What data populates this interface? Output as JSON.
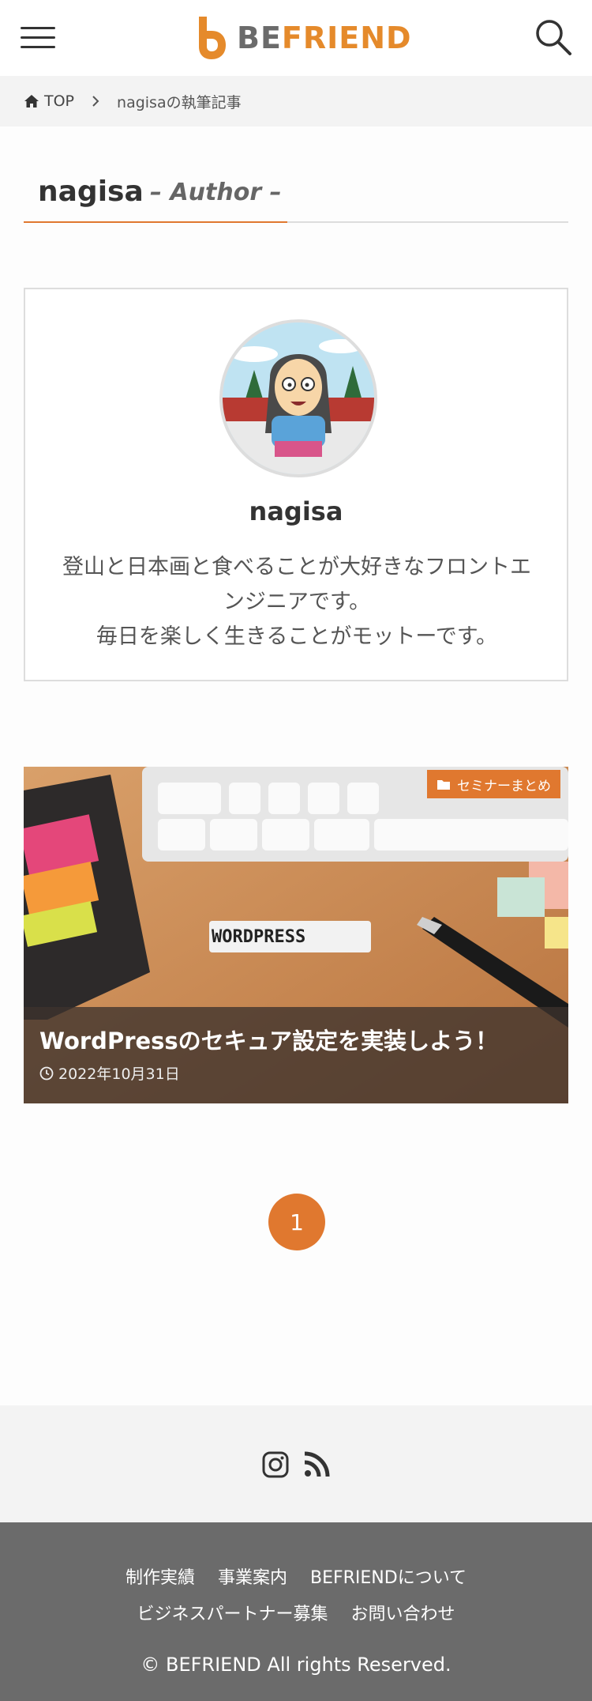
{
  "header": {
    "logo_prefix": "BE",
    "logo_suffix": "FRIEND",
    "logo_alt": "BEFRIEND",
    "colors": {
      "accent": "#e0782f",
      "logo_grey": "#6b6b6b"
    }
  },
  "breadcrumb": {
    "home_label": "TOP",
    "current_label": "nagisaの執筆記事"
  },
  "author_heading": {
    "name": "nagisa",
    "subtitle": "– Author –"
  },
  "profile": {
    "name": "nagisa",
    "bio_line1": "登山と日本画と食べることが大好きなフロントエンジニアです。",
    "bio_line2": "毎日を楽しく生きることがモットーです。",
    "avatar_icon": "cartoon-avatar"
  },
  "posts": [
    {
      "category": "セミナーまとめ",
      "title": "WordPressのセキュア設定を実装しよう！",
      "date": "2022年10月31日",
      "image_caption": "WORDPRESS"
    }
  ],
  "pagination": {
    "current": "1"
  },
  "footer": {
    "social_icons": [
      "instagram-icon",
      "rss-icon"
    ],
    "links_row1": [
      "制作実績",
      "事業案内",
      "BEFRIENDについて"
    ],
    "links_row2": [
      "ビジネスパートナー募集",
      "お問い合わせ"
    ],
    "copyright": "© BEFRIEND All rights Reserved."
  }
}
